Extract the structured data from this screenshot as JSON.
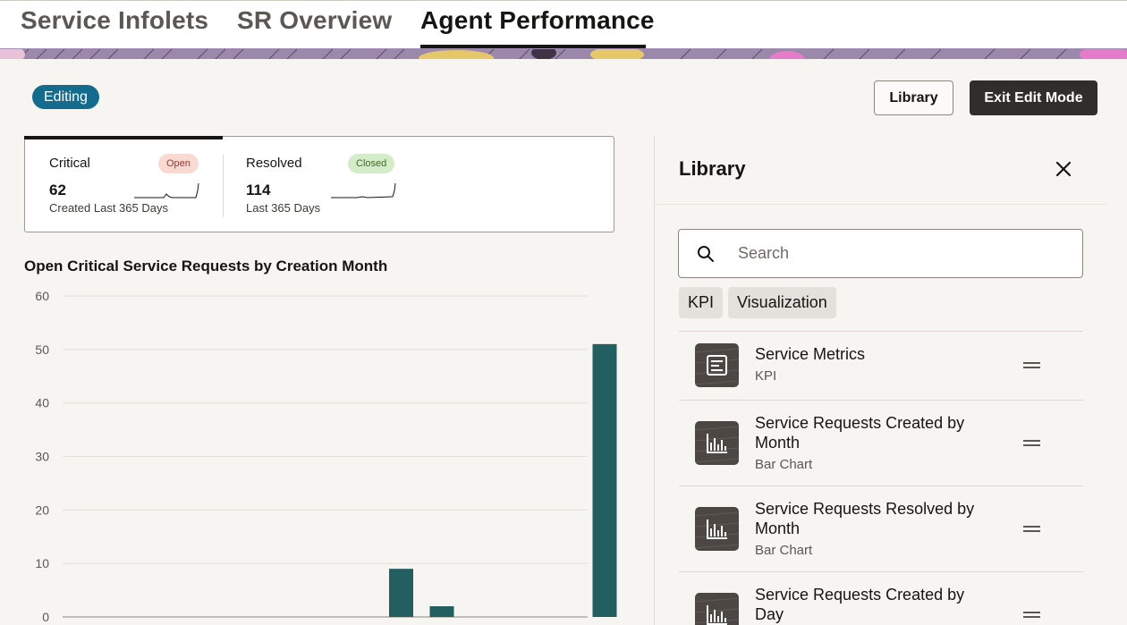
{
  "tabs": [
    {
      "label": "Service Infolets",
      "active": false
    },
    {
      "label": "SR Overview",
      "active": false
    },
    {
      "label": "Agent Performance",
      "active": true
    }
  ],
  "status_badge": "Editing",
  "buttons": {
    "library": "Library",
    "exit_edit": "Exit Edit Mode"
  },
  "kpis": [
    {
      "title": "Critical",
      "badge": "Open",
      "value": "62",
      "subtitle": "Created Last 365 Days"
    },
    {
      "title": "Resolved",
      "badge": "Closed",
      "value": "114",
      "subtitle": "Last 365 Days"
    }
  ],
  "chart_title": "Open Critical Service Requests by Creation Month",
  "chart_data": {
    "type": "bar",
    "title": "Open Critical Service Requests by Creation Month",
    "ylim": [
      0,
      60
    ],
    "yticks": [
      "0",
      "10",
      "20",
      "30",
      "40",
      "50",
      "60"
    ],
    "values": [
      0,
      0,
      0,
      0,
      0,
      0,
      0,
      9,
      2,
      0,
      0,
      0,
      51
    ],
    "color": "#235e61"
  },
  "library": {
    "title": "Library",
    "search_placeholder": "Search",
    "chips": [
      "KPI",
      "Visualization"
    ],
    "items": [
      {
        "name": "Service Metrics",
        "type": "KPI",
        "icon": "kpi-icon"
      },
      {
        "name": "Service Requests Created by Month",
        "type": "Bar Chart",
        "icon": "bar-chart-icon"
      },
      {
        "name": "Service Requests Resolved by Month",
        "type": "Bar Chart",
        "icon": "bar-chart-icon"
      },
      {
        "name": "Service Requests Created by Day",
        "type": "",
        "icon": "bar-chart-icon"
      }
    ]
  },
  "colors": {
    "accent": "#136b8e",
    "bar": "#235e61",
    "dark_button": "#312d2a"
  }
}
